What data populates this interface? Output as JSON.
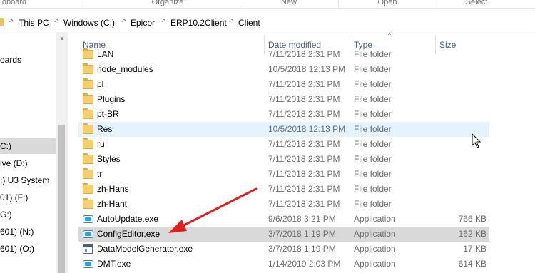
{
  "ribbon": {
    "groups": [
      "Clipboard",
      "Organize",
      "New",
      "Open",
      "Select"
    ],
    "visible_text": [
      "oboard",
      "Organize",
      "New",
      "Open",
      "Select"
    ]
  },
  "address_bar": {
    "crumbs": [
      "This PC",
      "Windows (C:)",
      "Epicor",
      "ERP10.2Client",
      "Client"
    ],
    "separator": ">"
  },
  "nav_pane": {
    "items": [
      {
        "label": "oards",
        "selected": false
      },
      {
        "label": "C:)",
        "selected": true
      },
      {
        "label": "ive (D:)",
        "selected": false
      },
      {
        "label": ":) U3 System",
        "selected": false
      },
      {
        "label": "01) (F:)",
        "selected": false
      },
      {
        "label": "G:)",
        "selected": false
      },
      {
        "label": "601) (N:)",
        "selected": false
      },
      {
        "label": "601) (O:)",
        "selected": false
      }
    ]
  },
  "columns": {
    "name": "Name",
    "date": "Date modified",
    "type": "Type",
    "size": "Size"
  },
  "files": [
    {
      "name": "LAN",
      "date": "7/11/2018 2:31 PM",
      "type": "File folder",
      "size": "",
      "icon": "folder-icon"
    },
    {
      "name": "node_modules",
      "date": "10/5/2018 12:13 PM",
      "type": "File folder",
      "size": "",
      "icon": "folder-icon"
    },
    {
      "name": "pl",
      "date": "7/11/2018 2:31 PM",
      "type": "File folder",
      "size": "",
      "icon": "folder-icon"
    },
    {
      "name": "Plugins",
      "date": "7/11/2018 2:31 PM",
      "type": "File folder",
      "size": "",
      "icon": "folder-icon"
    },
    {
      "name": "pt-BR",
      "date": "7/11/2018 2:31 PM",
      "type": "File folder",
      "size": "",
      "icon": "folder-icon"
    },
    {
      "name": "Res",
      "date": "10/5/2018 12:13 PM",
      "type": "File folder",
      "size": "",
      "icon": "folder-icon"
    },
    {
      "name": "ru",
      "date": "7/11/2018 2:31 PM",
      "type": "File folder",
      "size": "",
      "icon": "folder-icon"
    },
    {
      "name": "Styles",
      "date": "7/11/2018 2:31 PM",
      "type": "File folder",
      "size": "",
      "icon": "folder-icon"
    },
    {
      "name": "tr",
      "date": "7/11/2018 2:31 PM",
      "type": "File folder",
      "size": "",
      "icon": "folder-icon"
    },
    {
      "name": "zh-Hans",
      "date": "7/11/2018 2:31 PM",
      "type": "File folder",
      "size": "",
      "icon": "folder-icon"
    },
    {
      "name": "zh-Hant",
      "date": "7/11/2018 2:31 PM",
      "type": "File folder",
      "size": "",
      "icon": "folder-icon"
    },
    {
      "name": "AutoUpdate.exe",
      "date": "9/6/2018 3:21 PM",
      "type": "Application",
      "size": "766 KB",
      "icon": "app-icon"
    },
    {
      "name": "ConfigEditor.exe",
      "date": "3/7/2018 1:19 PM",
      "type": "Application",
      "size": "162 KB",
      "icon": "app-icon"
    },
    {
      "name": "DataModelGenerator.exe",
      "date": "3/7/2018 1:19 PM",
      "type": "Application",
      "size": "17 KB",
      "icon": "window-app-icon"
    },
    {
      "name": "DMT.exe",
      "date": "1/14/2019 2:03 PM",
      "type": "Application",
      "size": "614 KB",
      "icon": "app-icon"
    }
  ],
  "state": {
    "hover_row": "Res",
    "selected_row": "ConfigEditor.exe"
  },
  "colors": {
    "hover": "#e5f3ff",
    "selected": "#d9d9d9",
    "annotation_arrow": "#e02020",
    "folder": "#f3cf6d",
    "app_accent": "#1f88d8"
  }
}
